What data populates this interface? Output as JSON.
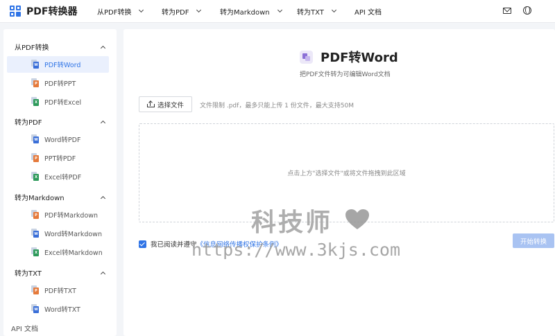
{
  "app": {
    "name": "PDF转换器"
  },
  "nav": [
    {
      "label": "从PDF转换",
      "has_dropdown": true
    },
    {
      "label": "转为PDF",
      "has_dropdown": true
    },
    {
      "label": "转为Markdown",
      "has_dropdown": true
    },
    {
      "label": "转为TXT",
      "has_dropdown": true
    },
    {
      "label": "API 文档",
      "has_dropdown": false
    }
  ],
  "top_icons": [
    "mail-icon",
    "globe-icon"
  ],
  "sidebar": {
    "groups": [
      {
        "title": "从PDF转换",
        "items": [
          {
            "label": "PDF转Word",
            "badge": "W",
            "color": "#3a6fd8",
            "active": true
          },
          {
            "label": "PDF转PPT",
            "badge": "P",
            "color": "#e57a3c",
            "active": false
          },
          {
            "label": "PDF转Excel",
            "badge": "X",
            "color": "#2e9a5b",
            "active": false
          }
        ]
      },
      {
        "title": "转为PDF",
        "items": [
          {
            "label": "Word转PDF",
            "badge": "W",
            "color": "#3a6fd8",
            "active": false
          },
          {
            "label": "PPT转PDF",
            "badge": "P",
            "color": "#e57a3c",
            "active": false
          },
          {
            "label": "Excel转PDF",
            "badge": "X",
            "color": "#2e9a5b",
            "active": false
          }
        ]
      },
      {
        "title": "转为Markdown",
        "items": [
          {
            "label": "PDF转Markdown",
            "badge": "P",
            "color": "#e57a3c",
            "active": false
          },
          {
            "label": "Word转Markdown",
            "badge": "W",
            "color": "#3a6fd8",
            "active": false
          },
          {
            "label": "Excel转Markdown",
            "badge": "X",
            "color": "#2e9a5b",
            "active": false
          }
        ]
      },
      {
        "title": "转为TXT",
        "items": [
          {
            "label": "PDF转TXT",
            "badge": "P",
            "color": "#e57a3c",
            "active": false
          },
          {
            "label": "Word转TXT",
            "badge": "W",
            "color": "#3a6fd8",
            "active": false
          }
        ]
      }
    ],
    "api_doc": "API 文档"
  },
  "main": {
    "title": "PDF转Word",
    "subtitle": "把PDF文件转为可编辑Word文档",
    "select_button": "选择文件",
    "limit_text": "文件限制 .pdf，最多只能上传 1 份文件，最大支持50M",
    "drop_hint": "点击上方\"选择文件\"或将文件拖拽到此区域",
    "agree_prefix": "我已阅读并遵守",
    "agree_link": "《信息网络传播权保护条例》",
    "agree_checked": true,
    "start_button": "开始转换"
  },
  "watermark": {
    "title": "科技师",
    "url": "https://www.3kjs.com"
  },
  "colors": {
    "accent": "#2f74e6",
    "start_disabled": "#a9c3f2"
  }
}
